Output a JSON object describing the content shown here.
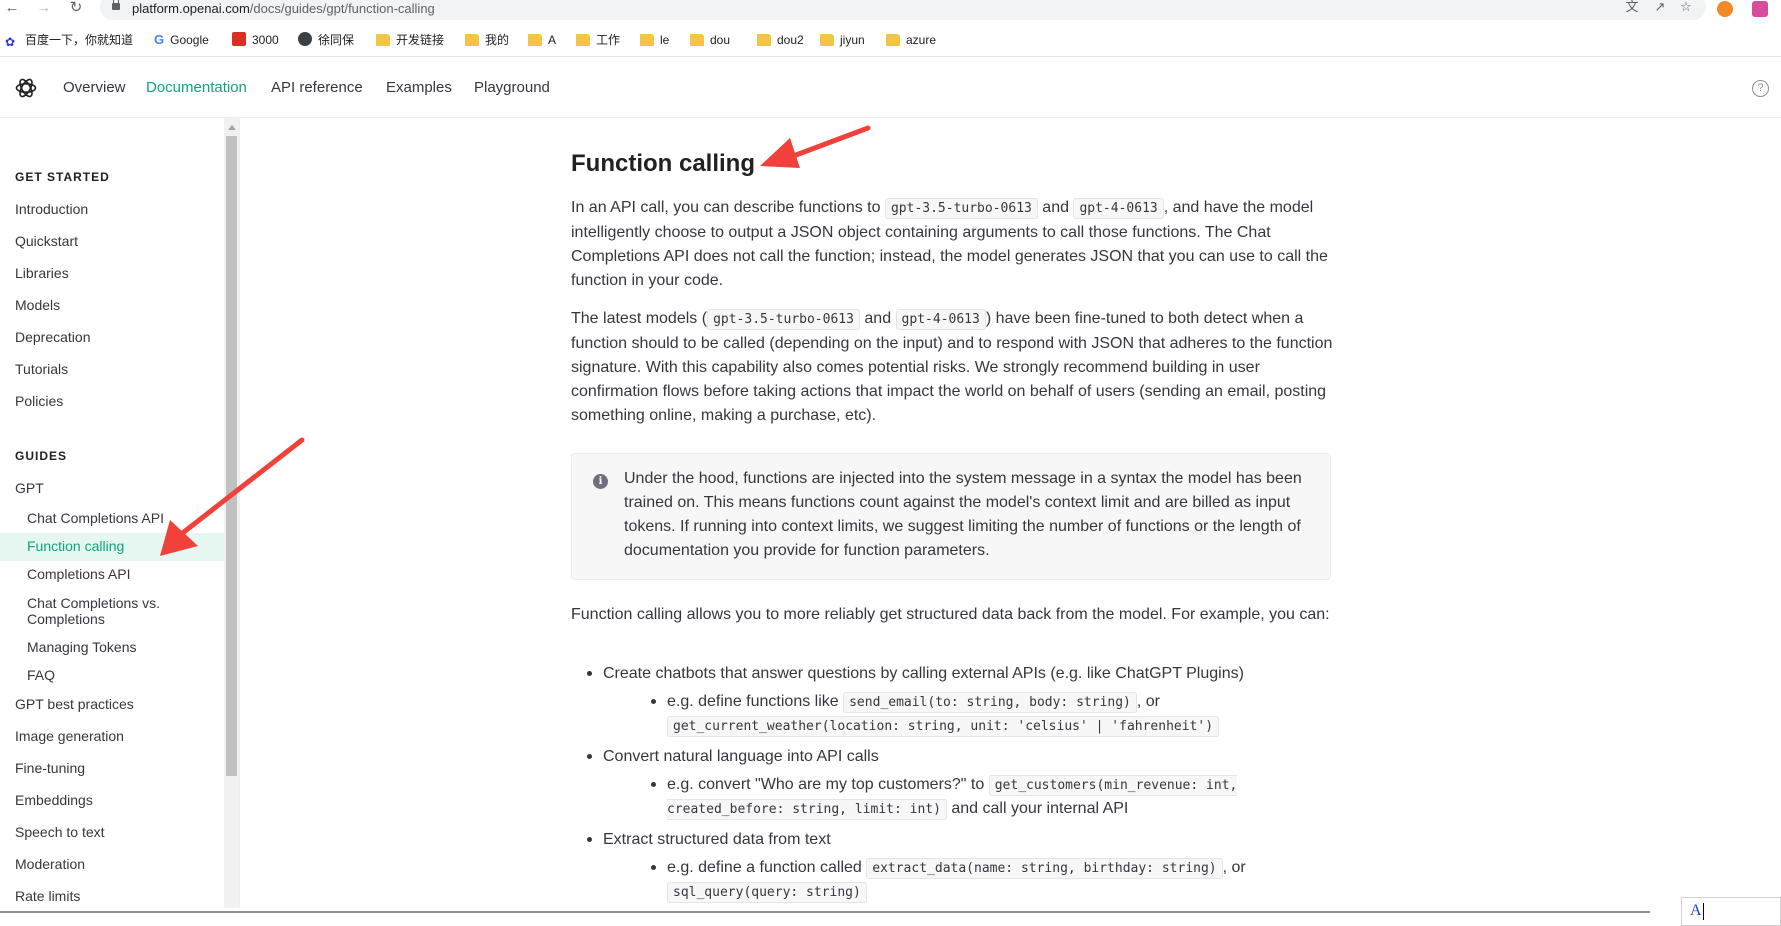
{
  "browser": {
    "url_host": "platform.openai.com",
    "url_path": "/docs/guides/gpt/function-calling",
    "bookmarks": [
      {
        "label": "百度一下，你就知道",
        "icon": "baidu-icon"
      },
      {
        "label": "Google",
        "icon": "google-icon"
      },
      {
        "label": "3000",
        "icon": "red-square-icon"
      },
      {
        "label": "徐同保",
        "icon": "globe-icon"
      },
      {
        "label": "开发链接",
        "icon": "folder-icon"
      },
      {
        "label": "我的",
        "icon": "folder-icon"
      },
      {
        "label": "A",
        "icon": "folder-icon"
      },
      {
        "label": "工作",
        "icon": "folder-icon"
      },
      {
        "label": "le",
        "icon": "folder-icon"
      },
      {
        "label": "dou",
        "icon": "folder-icon"
      },
      {
        "label": "dou2",
        "icon": "folder-icon"
      },
      {
        "label": "jiyun",
        "icon": "folder-icon"
      },
      {
        "label": "azure",
        "icon": "folder-icon"
      }
    ]
  },
  "header": {
    "nav": [
      "Overview",
      "Documentation",
      "API reference",
      "Examples",
      "Playground"
    ],
    "active": "Documentation"
  },
  "sidebar": {
    "get_started_heading": "GET STARTED",
    "get_started": [
      "Introduction",
      "Quickstart",
      "Libraries",
      "Models",
      "Deprecation",
      "Tutorials",
      "Policies"
    ],
    "guides_heading": "GUIDES",
    "gpt": "GPT",
    "gpt_sub": [
      "Chat Completions API",
      "Function calling",
      "Completions API",
      "Chat Completions vs. Completions",
      "Managing Tokens",
      "FAQ"
    ],
    "active": "Function calling",
    "guides": [
      "GPT best practices",
      "Image generation",
      "Fine-tuning",
      "Embeddings",
      "Speech to text",
      "Moderation",
      "Rate limits"
    ]
  },
  "content": {
    "title": "Function calling",
    "p1": {
      "a": "In an API call, you can describe functions to ",
      "code1": "gpt-3.5-turbo-0613",
      "b": " and ",
      "code2": "gpt-4-0613",
      "c": ", and have the model intelligently choose to output a JSON object containing arguments to call those functions. The Chat Completions API does not call the function; instead, the model generates JSON that you can use to call the function in your code."
    },
    "p2": {
      "a": "The latest models (",
      "code1": "gpt-3.5-turbo-0613",
      "b": " and ",
      "code2": "gpt-4-0613",
      "c": ") have been fine-tuned to both detect when a function should to be called (depending on the input) and to respond with JSON that adheres to the function signature. With this capability also comes potential risks. We strongly recommend building in user confirmation flows before taking actions that impact the world on behalf of users (sending an email, posting something online, making a purchase, etc)."
    },
    "note": "Under the hood, functions are injected into the system message in a syntax the model has been trained on. This means functions count against the model's context limit and are billed as input tokens. If running into context limits, we suggest limiting the number of functions or the length of documentation you provide for function parameters.",
    "p3": "Function calling allows you to more reliably get structured data back from the model. For example, you can:",
    "bullets": [
      {
        "text": "Create chatbots that answer questions by calling external APIs (e.g. like ChatGPT Plugins)",
        "sub": {
          "a": "e.g. define functions like ",
          "code1": "send_email(to: string, body: string)",
          "b": ", or ",
          "code2": "get_current_weather(location: string, unit: 'celsius' | 'fahrenheit')",
          "c": ""
        }
      },
      {
        "text": "Convert natural language into API calls",
        "sub": {
          "a": "e.g. convert \"Who are my top customers?\" to ",
          "code1": "get_customers(min_revenue: int, created_before: string, limit: int)",
          "b": " and call your internal API",
          "code2": "",
          "c": ""
        }
      },
      {
        "text": "Extract structured data from text",
        "sub": {
          "a": "e.g. define a function called ",
          "code1": "extract_data(name: string, birthday: string)",
          "b": ", or ",
          "code2": "sql_query(query: string)",
          "c": ""
        }
      }
    ]
  },
  "ime": {
    "text": "A"
  },
  "colors": {
    "accent": "#10a37f",
    "annotation_arrow": "#f0413a"
  }
}
